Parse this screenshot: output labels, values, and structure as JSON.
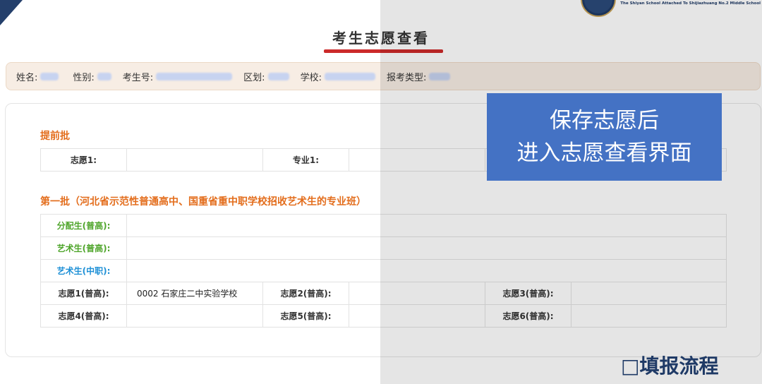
{
  "header": {
    "logo_text": "The Shiyan School Attached To Shijiazhuang No.2 Middle School"
  },
  "page_title": "考生志愿查看",
  "info": {
    "name_label": "姓名:",
    "gender_label": "性别:",
    "exam_no_label": "考生号:",
    "district_label": "区划:",
    "school_label": "学校:",
    "type_label": "报考类型:"
  },
  "early_batch": {
    "title": "提前批",
    "choice1_label": "志愿1:",
    "major1_label": "专业1:"
  },
  "first_batch": {
    "title": "第一批（河北省示范性普通高中、国重省重中职学校招收艺术生的专业班）",
    "allocated_label": "分配生(普高):",
    "art_general_label": "艺术生(普高):",
    "art_vocational_label": "艺术生(中职):",
    "c1_label": "志愿1(普高):",
    "c1_value": "0002 石家庄二中实验学校",
    "c2_label": "志愿2(普高):",
    "c3_label": "志愿3(普高):",
    "c4_label": "志愿4(普高):",
    "c5_label": "志愿5(普高):",
    "c6_label": "志愿6(普高):"
  },
  "callout": {
    "line1": "保存志愿后",
    "line2": "进入志愿查看界面"
  },
  "footer": {
    "flow_label": "□填报流程"
  },
  "colors": {
    "accent_red": "#cc2a2a",
    "section_orange": "#e36d1c",
    "label_green": "#4fa52b",
    "label_blue": "#1e90d6",
    "callout_blue": "#4472c4",
    "navy": "#1f3a66"
  }
}
